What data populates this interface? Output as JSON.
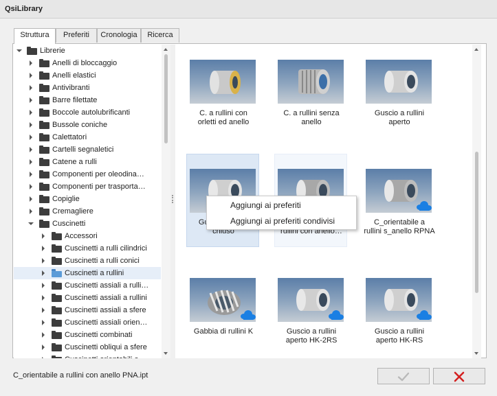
{
  "window": {
    "title": "QsiLibrary"
  },
  "tabs": [
    {
      "label": "Struttura",
      "active": true
    },
    {
      "label": "Preferiti",
      "active": false
    },
    {
      "label": "Cronologia",
      "active": false
    },
    {
      "label": "Ricerca",
      "active": false
    }
  ],
  "tree": {
    "root": "Librerie",
    "items": [
      "Anelli di bloccaggio",
      "Anelli elastici",
      "Antivibranti",
      "Barre filettate",
      "Boccole autolubrificanti",
      "Bussole coniche",
      "Calettatori",
      "Cartelli segnaletici",
      "Catene a rulli",
      "Componenti per oleodina…",
      "Componenti per trasporta…",
      "Copiglie",
      "Cremagliere",
      "Cuscinetti"
    ],
    "children": [
      "Accessori",
      "Cuscinetti a rulli cilindrici",
      "Cuscinetti a rulli conici",
      "Cuscinetti a rullini",
      "Cuscinetti assiali a rulli…",
      "Cuscinetti assiali a rullini",
      "Cuscinetti assiali a sfere",
      "Cuscinetti assiali orien…",
      "Cuscinetti combinati",
      "Cuscinetti obliqui a sfere",
      "Cuscinetti orientabili a…"
    ],
    "selected_child": "Cuscinetti a rullini"
  },
  "grid": {
    "items": [
      {
        "caption": "C. a rullini con\norletti ed anello",
        "image": "needle-bearing-brass-render",
        "cloud": false
      },
      {
        "caption": "C. a rullini senza\nanello",
        "image": "needle-bearing-cage-render",
        "cloud": false
      },
      {
        "caption": "Guscio a rullini\naperto",
        "image": "drawn-cup-render",
        "cloud": false
      },
      {
        "caption": "Guscio a rullini\nchiuso",
        "image": "closed-cup-render",
        "cloud": false
      },
      {
        "caption": "C_orientabile a\nrullini con anello…",
        "image": "self-aligning-render",
        "cloud": true
      },
      {
        "caption": "C_orientabile a\nrullini s_anello RPNA",
        "image": "self-aligning-render",
        "cloud": true
      },
      {
        "caption": "Gabbia di rullini K",
        "image": "needle-cage-render",
        "cloud": true
      },
      {
        "caption": "Guscio a rullini\naperto HK-2RS",
        "image": "drawn-cup-render",
        "cloud": true
      },
      {
        "caption": "Guscio a rullini\naperto HK-RS",
        "image": "drawn-cup-render",
        "cloud": true
      }
    ]
  },
  "context_menu": {
    "items": [
      "Aggiungi ai preferiti",
      "Aggiungi ai preferiti condivisi"
    ]
  },
  "status": {
    "text": "C_orientabile a rullini con anello PNA.ipt"
  },
  "buttons": {
    "ok_icon": "check-icon",
    "cancel_icon": "cross-icon"
  },
  "colors": {
    "cloud": "#1a7fe3",
    "cancel": "#d42020",
    "selection": "#dde8f5"
  }
}
